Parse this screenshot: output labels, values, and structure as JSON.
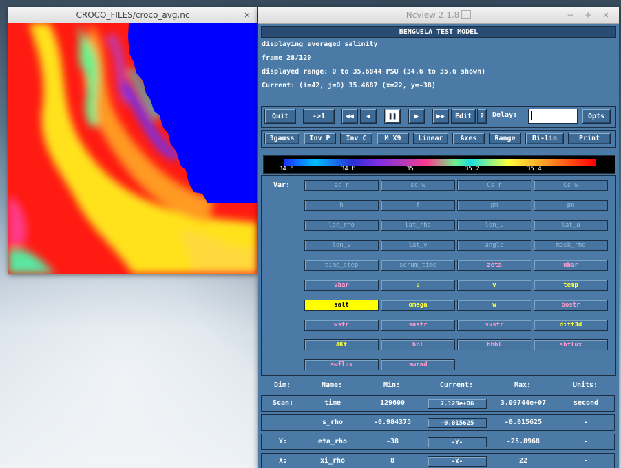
{
  "image_window": {
    "title": "CROCO_FILES/croco_avg.nc",
    "close": "×"
  },
  "ncview": {
    "title": "Ncview 2.1.8",
    "window_controls": "− + ×",
    "model_title": "BENGUELA TEST MODEL",
    "info": [
      "displaying averaged salinity",
      "frame 28/120",
      "displayed range: 0 to 35.6844 PSU (34.6 to 35.6 shown)",
      "Current: (i=42, j=0) 35.4687 (x=22, y=-38)"
    ],
    "controls": {
      "quit": "Quit",
      "to_one": "->1",
      "rewind": "◀◀",
      "back": "◀",
      "pause": "❚❚",
      "forward": "▶",
      "fast_forward": "▶▶",
      "edit": "Edit",
      "help": "?",
      "delay": "Delay:",
      "opts": "Opts"
    },
    "options": [
      "3gauss",
      "Inv P",
      "Inv C",
      "M X9",
      "Linear",
      "Axes",
      "Range",
      "Bi-lin",
      "Print"
    ],
    "colorbar": {
      "ticks": [
        "34.6",
        "34.8",
        "35",
        "35.2",
        "35.4"
      ],
      "colors": [
        "#1a2bff",
        "#00bfff",
        "#7d2ee0",
        "#ff3a8a",
        "#6ef08a",
        "#ffff3a",
        "#ff9a24",
        "#ff0000"
      ]
    },
    "var_label": "Var:",
    "variables": [
      {
        "name": "sc_r",
        "style": "dim"
      },
      {
        "name": "sc_w",
        "style": "dim"
      },
      {
        "name": "Cs_r",
        "style": "dim"
      },
      {
        "name": "Cs_w",
        "style": "dim"
      },
      {
        "name": "h",
        "style": "dim"
      },
      {
        "name": "f",
        "style": "dim"
      },
      {
        "name": "pm",
        "style": "dim"
      },
      {
        "name": "pn",
        "style": "dim"
      },
      {
        "name": "lon_rho",
        "style": "dim"
      },
      {
        "name": "lat_rho",
        "style": "dim"
      },
      {
        "name": "lon_u",
        "style": "dim"
      },
      {
        "name": "lat_u",
        "style": "dim"
      },
      {
        "name": "lon_v",
        "style": "dim"
      },
      {
        "name": "lat_v",
        "style": "dim"
      },
      {
        "name": "angle",
        "style": "dim"
      },
      {
        "name": "mask_rho",
        "style": "dim"
      },
      {
        "name": "time_step",
        "style": "dim"
      },
      {
        "name": "scrum_time",
        "style": "dim"
      },
      {
        "name": "zeta",
        "style": "pink"
      },
      {
        "name": "ubar",
        "style": "pink"
      },
      {
        "name": "vbar",
        "style": "pink"
      },
      {
        "name": "u",
        "style": "yellow"
      },
      {
        "name": "v",
        "style": "yellow"
      },
      {
        "name": "temp",
        "style": "yellow"
      },
      {
        "name": "salt",
        "style": "selected"
      },
      {
        "name": "omega",
        "style": "yellow"
      },
      {
        "name": "w",
        "style": "yellow"
      },
      {
        "name": "bostr",
        "style": "pink"
      },
      {
        "name": "wstr",
        "style": "pink"
      },
      {
        "name": "sustr",
        "style": "pink"
      },
      {
        "name": "svstr",
        "style": "pink"
      },
      {
        "name": "diff3d",
        "style": "yellow"
      },
      {
        "name": "AKt",
        "style": "yellow"
      },
      {
        "name": "hbl",
        "style": "pink"
      },
      {
        "name": "hbbl",
        "style": "pink"
      },
      {
        "name": "shflux",
        "style": "pink"
      },
      {
        "name": "swflux",
        "style": "pink"
      },
      {
        "name": "swrad",
        "style": "pink"
      }
    ],
    "dim_header": {
      "dim": "Dim:",
      "name": "Name:",
      "min": "Min:",
      "current": "Current:",
      "max": "Max:",
      "units": "Units:"
    },
    "dims": [
      {
        "dim": "Scan:",
        "name": "time",
        "min": "129600",
        "current": "7.128e+06",
        "max": "3.09744e+07",
        "units": "second"
      },
      {
        "dim": "",
        "name": "s_rho",
        "min": "-0.984375",
        "current": "-0.015625",
        "max": "-0.015625",
        "units": "-"
      },
      {
        "dim": "Y:",
        "name": "eta_rho",
        "min": "-38",
        "current": "-Y-",
        "max": "-25.8968",
        "units": "-"
      },
      {
        "dim": "X:",
        "name": "xi_rho",
        "min": "8",
        "current": "-X-",
        "max": "22",
        "units": "-"
      }
    ]
  }
}
